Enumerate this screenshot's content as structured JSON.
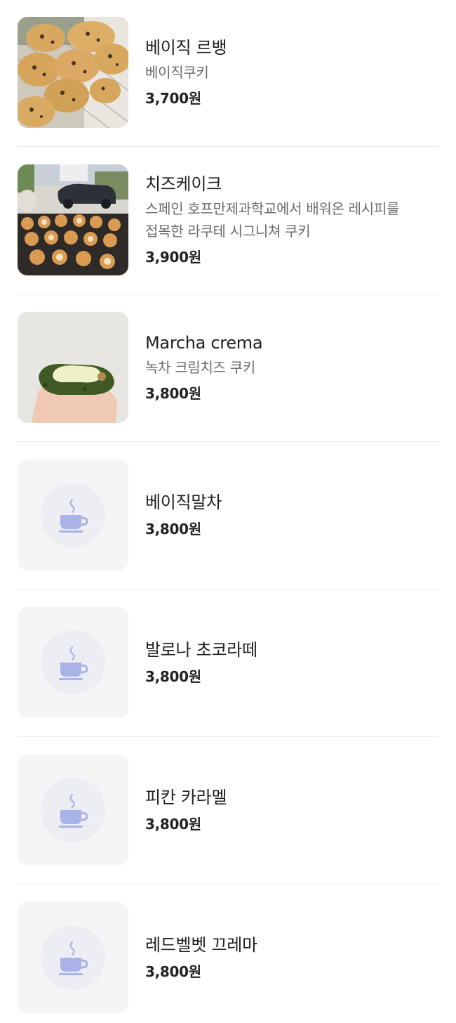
{
  "menu": {
    "items": [
      {
        "name": "베이직 르뱅",
        "description": "베이직쿠키",
        "price": "3,700원",
        "image": "cookie-tray-photo"
      },
      {
        "name": "치즈케이크",
        "description": "스페인 호프만제과학교에서 배워온 레시피를\n접목한 라쿠테 시그니쳐 쿠키",
        "price": "3,900원",
        "image": "cheesecake-cookies-photo"
      },
      {
        "name": "Marcha crema",
        "description": "녹차 크림치즈 쿠키",
        "price": "3,800원",
        "image": "matcha-cookie-photo"
      },
      {
        "name": "베이직말차",
        "price": "3,800원",
        "image": "coffee-cup-icon"
      },
      {
        "name": "발로나 초코라떼",
        "price": "3,800원",
        "image": "coffee-cup-icon"
      },
      {
        "name": "피칸 카라멜",
        "price": "3,800원",
        "image": "coffee-cup-icon"
      },
      {
        "name": "레드벨벳 끄레마",
        "price": "3,800원",
        "image": "coffee-cup-icon"
      }
    ]
  },
  "colors": {
    "placeholder_bg": "#f5f5f6",
    "placeholder_circle": "#eceef4",
    "cup_icon": "#a9b3e8",
    "divider": "#ececec"
  }
}
